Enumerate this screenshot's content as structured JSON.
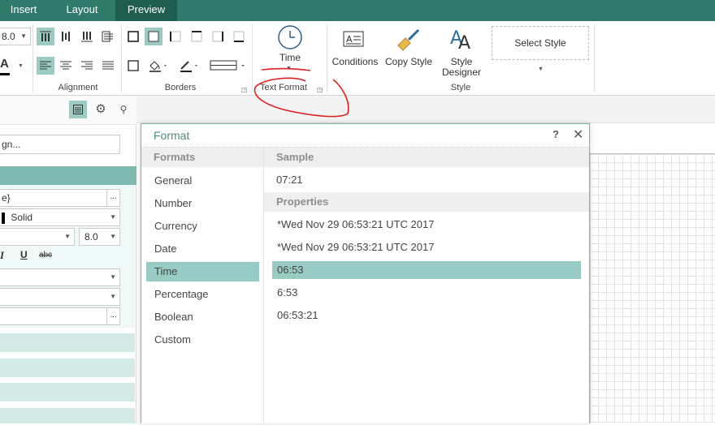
{
  "tabs": [
    {
      "label": "Insert",
      "active": false
    },
    {
      "label": "Layout",
      "active": false
    },
    {
      "label": "Preview",
      "active": true
    }
  ],
  "ribbon": {
    "font_size": "8.0",
    "font_color_glyph": "A",
    "groups": {
      "alignment": "Alignment",
      "borders": "Borders",
      "text_format": "Text Format",
      "style": "Style"
    },
    "buttons": {
      "time": "Time",
      "conditions": "Conditions",
      "copy_style": "Copy Style",
      "style_designer_line1": "Style",
      "style_designer_line2": "Designer",
      "select_style": "Select Style"
    }
  },
  "left_panel": {
    "field1": "gn...",
    "field2": "e}",
    "border_style": "Solid",
    "size2": "8.0",
    "ellipsis": "...",
    "text_styles": {
      "italic": "I",
      "underline": "U",
      "strike": "abc"
    }
  },
  "dialog": {
    "title": "Format",
    "help": "?",
    "close": "✕",
    "formats_header": "Formats",
    "formats": [
      "General",
      "Number",
      "Currency",
      "Date",
      "Time",
      "Percentage",
      "Boolean",
      "Custom"
    ],
    "selected_format": "Time",
    "sample_header": "Sample",
    "sample_value": "07:21",
    "properties_header": "Properties",
    "properties": [
      "*Wed Nov 29 06:53:21 UTC 2017",
      "*Wed Nov 29 06:53:21 UTC 2017",
      "06:53",
      "6:53",
      "06:53:21"
    ],
    "selected_property": "06:53"
  },
  "colors": {
    "tab_bar": "#2f7a6b",
    "tab_active": "#1f5d50",
    "selection": "#97cbc3",
    "accent_text": "#4c8c80",
    "annotation": "#e02020"
  }
}
